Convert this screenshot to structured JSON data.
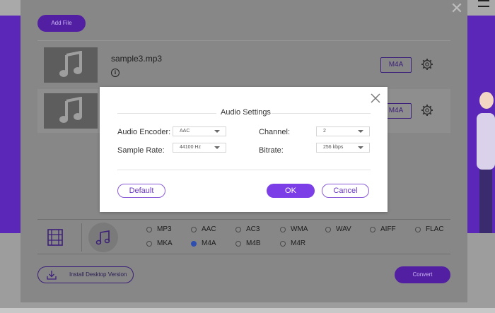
{
  "panel": {
    "add_file_label": "Add File",
    "files": [
      {
        "name": "sample3.mp3",
        "format": "M4A"
      },
      {
        "name": "",
        "format": "M4A"
      }
    ],
    "audio_formats": [
      "MP3",
      "AAC",
      "AC3",
      "WMA",
      "WAV",
      "AIFF",
      "FLAC",
      "MKA",
      "M4A",
      "M4B",
      "M4R"
    ],
    "selected_format": "M4A",
    "install_label": "Install Desktop Version",
    "convert_label": "Convert"
  },
  "dialog": {
    "title": "Audio Settings",
    "encoder_label": "Audio Encoder:",
    "encoder_value": "AAC",
    "channel_label": "Channel:",
    "channel_value": "2",
    "sample_rate_label": "Sample Rate:",
    "sample_rate_value": "44100 Hz",
    "bitrate_label": "Bitrate:",
    "bitrate_value": "256 kbps",
    "default_label": "Default",
    "ok_label": "OK",
    "cancel_label": "Cancel"
  },
  "colors": {
    "accent": "#7c3ee6",
    "panel_accent_dim": "#521fa3",
    "background_brand": "#5a27b8"
  },
  "icons": [
    "close-icon",
    "music-note-icon",
    "info-icon",
    "gear-icon",
    "film-icon",
    "download-icon",
    "hamburger-icon"
  ]
}
